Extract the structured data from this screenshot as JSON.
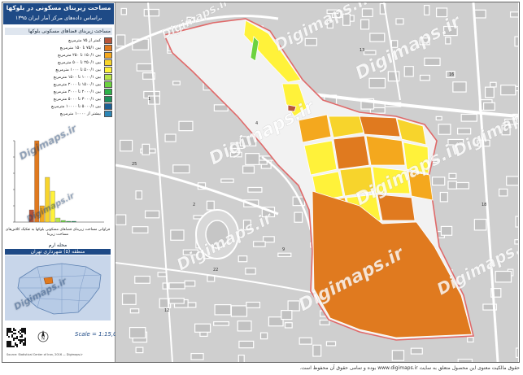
{
  "title_line1": "مساحت زیربنای مسکونی در بلوکها",
  "title_line2": "براساس داده‌های مرکز آمار ایران ۱۳۹۵",
  "legend_header": "مساحت زیربنای فضاهای مسکونی بلوکها",
  "legend": [
    {
      "label": "کمتر از ۷۵ مترمربع",
      "color": "#b8553a"
    },
    {
      "label": "بین ۷۵/۱ تا ۱۵۰ مترمربع",
      "color": "#e07a1f"
    },
    {
      "label": "بین ۱۵۰/۱ تا ۲۵۰ مترمربع",
      "color": "#f4a81e"
    },
    {
      "label": "بین ۲۵۰/۱ تا ۵۰۰ مترمربع",
      "color": "#f7d42c"
    },
    {
      "label": "بین ۵۰۰/۱ تا ۱۰۰۰ مترمربع",
      "color": "#fff23a"
    },
    {
      "label": "بین ۱۰۰۰/۱ تا ۱۵۰۰ مترمربع",
      "color": "#b7e34a"
    },
    {
      "label": "بین ۱۵۰۰/۱ تا ۲۰۰۰ مترمربع",
      "color": "#6cd23f"
    },
    {
      "label": "بین ۲۰۰۰/۱ تا ۳۰۰۰ مترمربع",
      "color": "#2fb24a"
    },
    {
      "label": "بین ۳۰۰۰/۱ تا ۵۰۰۰ مترمربع",
      "color": "#1e8f5c"
    },
    {
      "label": "بین ۵۰۰۰/۱ تا ۱۰۰۰۰ مترمربع",
      "color": "#1d5f93"
    },
    {
      "label": "بیشتر از ۱۰۰۰۰ مترمربع",
      "color": "#2c86b6"
    }
  ],
  "chart_data": {
    "type": "bar",
    "title": "",
    "xlabel": "",
    "ylabel": "",
    "ylim": [
      0,
      100
    ],
    "values": [
      15,
      100,
      20,
      55,
      38,
      5,
      2,
      1,
      1,
      0,
      0
    ],
    "colors": [
      "#b8553a",
      "#e07a1f",
      "#f4a81e",
      "#f7d42c",
      "#fff23a",
      "#b7e34a",
      "#6cd23f",
      "#2fb24a",
      "#1e8f5c",
      "#1d5f93",
      "#2c86b6"
    ],
    "ytick_count": 5
  },
  "chart_caption": "فراوانی مساحت زیربنای فضاهای مسکونی بلوکها\nبه تفکیک کلاس‌های مساحت زیربنا",
  "locator_title": "محله ارم",
  "locator_subtitle": "منطقه (۵) شهرداری تهران",
  "scale_text": "Scale = 1:15,000",
  "north_label": "N",
  "credit_text": "Source: Statistical Center of Iran, 2016 — Digimaps.ir",
  "watermark": "Digimaps.ir",
  "footer_text": "حقوق مالکیت معنوی این محصول متعلق به سایت www.digimaps.ir بوده و تمامی حقوق آن محفوظ است.",
  "map_labels": [
    "1",
    "2",
    "4",
    "9",
    "12",
    "13",
    "16",
    "18",
    "22",
    "25"
  ],
  "colors": {
    "boundary": "#e06a6a",
    "base_map": "#cfcfcf",
    "roads": "#ffffff",
    "title_bar": "#1e4a86"
  }
}
